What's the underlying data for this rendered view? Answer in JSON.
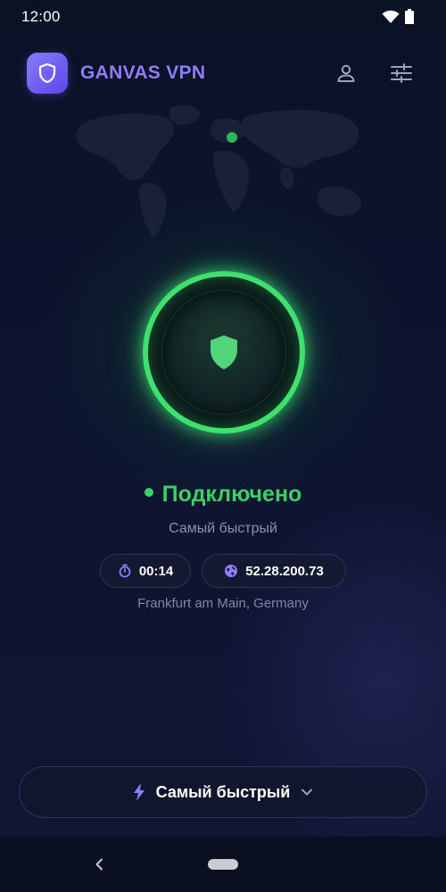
{
  "statusbar": {
    "time": "12:00",
    "icons": [
      "wifi-icon",
      "battery-icon"
    ]
  },
  "header": {
    "app_name": "GANVAS VPN",
    "logo_icon": "shield-icon",
    "profile_icon": "person-icon",
    "settings_icon": "sliders-icon"
  },
  "connection": {
    "status": "Подключено",
    "server_mode": "Самый быстрый",
    "timer": "00:14",
    "ip": "52.28.200.73",
    "location": "Frankfurt am Main, Germany"
  },
  "server_selector": {
    "label": "Самый быстрый",
    "icon": "lightning-icon"
  },
  "colors": {
    "accent": "#8f7dff",
    "connected": "#3ccf64",
    "background": "#0d1430"
  }
}
